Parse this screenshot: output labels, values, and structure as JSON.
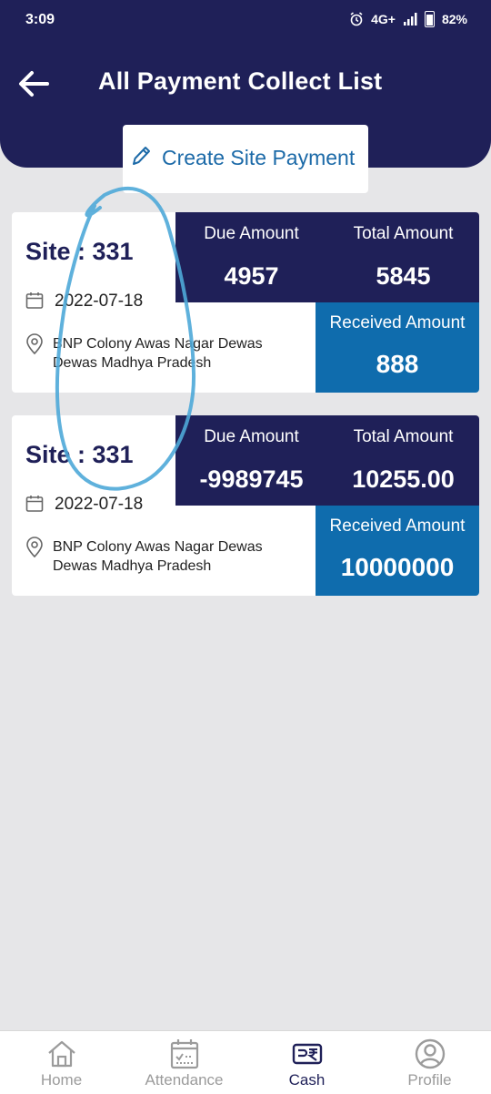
{
  "status_bar": {
    "time": "3:09",
    "network": "4G+",
    "battery": "82%"
  },
  "header": {
    "title": "All Payment Collect List"
  },
  "create_button": {
    "label": "Create Site Payment"
  },
  "cards": [
    {
      "site": "Site : 331",
      "date": "2022-07-18",
      "address": "BNP Colony Awas Nagar Dewas Dewas Madhya Pradesh",
      "due_label": "Due Amount",
      "due_value": "4957",
      "total_label": "Total Amount",
      "total_value": "5845",
      "received_label": "Received Amount",
      "received_value": "888"
    },
    {
      "site": "Site : 331",
      "date": "2022-07-18",
      "address": "BNP Colony Awas Nagar Dewas Dewas Madhya Pradesh",
      "due_label": "Due Amount",
      "due_value": "-9989745",
      "total_label": "Total Amount",
      "total_value": "10255.00",
      "received_label": "Received Amount",
      "received_value": "10000000"
    }
  ],
  "bottom_nav": {
    "items": [
      {
        "label": "Home",
        "icon": "home-icon"
      },
      {
        "label": "Attendance",
        "icon": "calendar-check-icon"
      },
      {
        "label": "Cash",
        "icon": "rupee-wallet-icon"
      },
      {
        "label": "Profile",
        "icon": "user-circle-icon"
      }
    ],
    "active": "Cash"
  },
  "colors": {
    "primary": "#1f2058",
    "accent": "#0f6cad",
    "link": "#1c6aa8",
    "background": "#e6e6e8"
  }
}
